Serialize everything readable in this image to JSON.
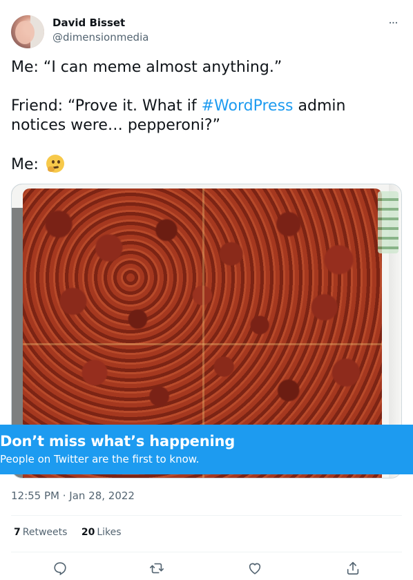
{
  "author": {
    "name": "David Bisset",
    "handle": "@dimensionmedia",
    "more_label": "···"
  },
  "tweet": {
    "line1": "Me: “I can meme almost anything.”",
    "line2_before": "Friend: “Prove it. What if ",
    "hashtag": "#WordPress",
    "line2_after": " admin notices were… pepperoni?”",
    "line3": "Me: ",
    "emoji": "thinking-face-emoji"
  },
  "media": {
    "description_icon": "pizza-photo"
  },
  "banner": {
    "title": "Don’t miss what’s happening",
    "subtitle": "People on Twitter are the first to know."
  },
  "timestamp": "12:55 PM · Jan 28, 2022",
  "stats": {
    "retweets_count": "7",
    "retweets_label": "Retweets",
    "likes_count": "20",
    "likes_label": "Likes"
  },
  "actions": [
    "reply-icon",
    "retweet-icon",
    "like-icon",
    "share-icon"
  ],
  "colors": {
    "accent": "#1d9bf0",
    "text": "#0f1419",
    "secondary": "#536471",
    "border": "#eff3f4"
  }
}
